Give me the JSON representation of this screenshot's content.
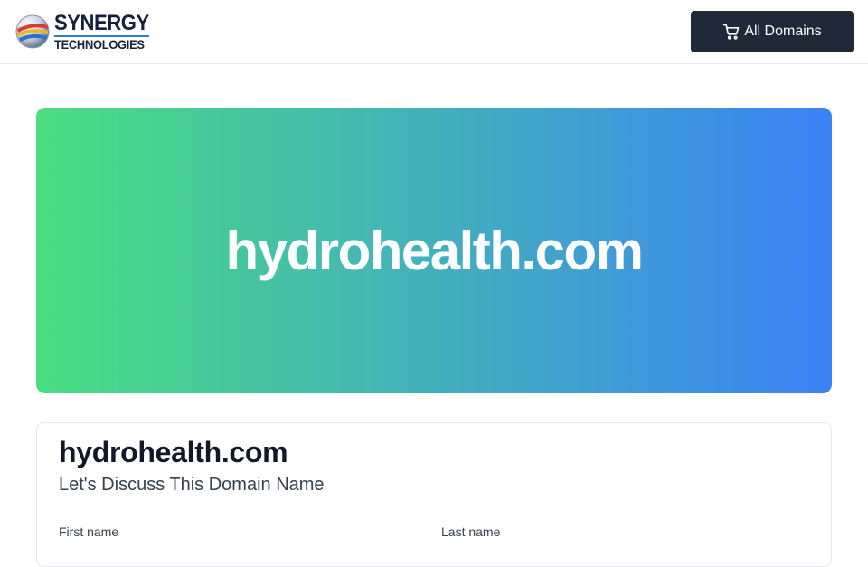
{
  "header": {
    "logo": {
      "line1": "SYNERGY",
      "line2": "TECHNOLOGIES",
      "icon": "globe-icon"
    },
    "all_domains_button": {
      "label": "All Domains",
      "icon": "cart-icon"
    }
  },
  "hero": {
    "domain": "hydrohealth.com"
  },
  "card": {
    "title": "hydrohealth.com",
    "subtitle": "Let's Discuss This Domain Name",
    "fields": {
      "first_name_label": "First name",
      "last_name_label": "Last name"
    }
  },
  "colors": {
    "header_bg": "#ffffff",
    "button_bg": "#1f2937",
    "gradient_start": "#4ade80",
    "gradient_end": "#3b82f6",
    "text_dark": "#111827",
    "text_muted": "#374151"
  }
}
